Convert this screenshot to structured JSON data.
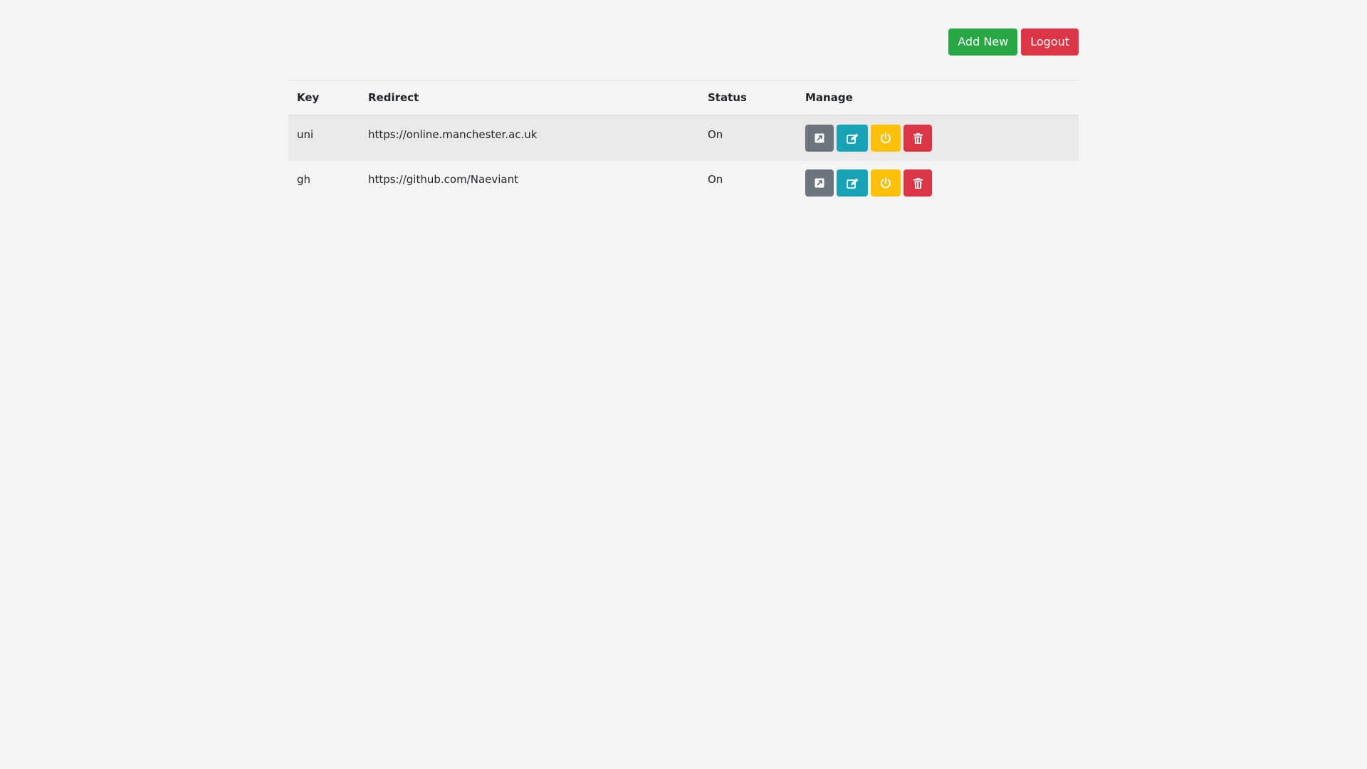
{
  "header": {
    "add_new_label": "Add New",
    "logout_label": "Logout"
  },
  "table": {
    "columns": {
      "key": "Key",
      "redirect": "Redirect",
      "status": "Status",
      "manage": "Manage"
    },
    "rows": [
      {
        "key": "uni",
        "redirect": "https://online.manchester.ac.uk",
        "status": "On"
      },
      {
        "key": "gh",
        "redirect": "https://github.com/Naeviant",
        "status": "On"
      }
    ],
    "manage_icons": [
      "external-link-icon",
      "edit-icon",
      "power-icon",
      "trash-icon"
    ]
  },
  "colors": {
    "success": "#28a745",
    "danger": "#dc3545",
    "secondary": "#6c757d",
    "info": "#17a2b8",
    "warning": "#ffc107",
    "background": "#f5f5f5",
    "stripe": "#e9e9e9"
  }
}
